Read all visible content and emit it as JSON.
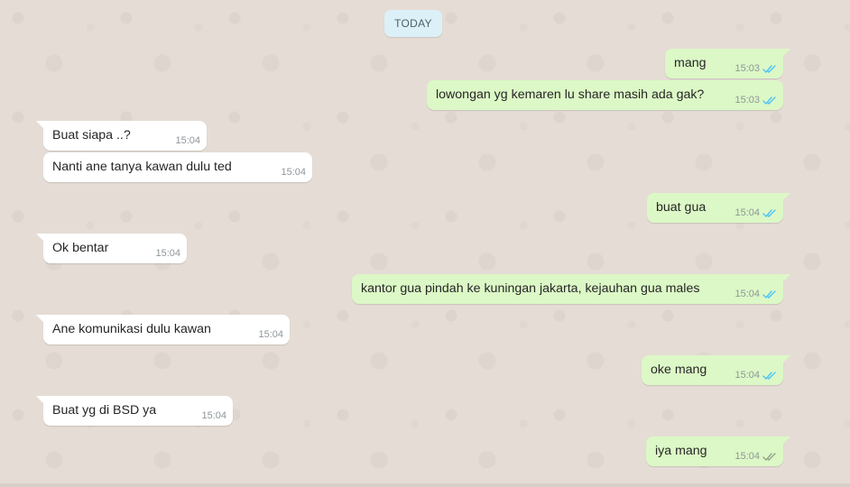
{
  "chat": {
    "date_divider": "TODAY",
    "colors": {
      "incoming_bubble": "#ffffff",
      "outgoing_bubble": "#dcf8c6",
      "read_tick": "#4fc3f7",
      "delivered_tick": "#92a58c",
      "wallpaper": "#e5ddd5"
    },
    "messages": [
      {
        "direction": "out",
        "text": "mang",
        "time": "15:03",
        "status": "read"
      },
      {
        "direction": "out",
        "text": "lowongan yg kemaren lu share masih ada gak?",
        "time": "15:03",
        "status": "read"
      },
      {
        "direction": "in",
        "text": "Buat siapa ..?",
        "time": "15:04"
      },
      {
        "direction": "in",
        "text": "Nanti ane tanya kawan dulu ted",
        "time": "15:04"
      },
      {
        "direction": "out",
        "text": "buat gua",
        "time": "15:04",
        "status": "read"
      },
      {
        "direction": "in",
        "text": "Ok bentar",
        "time": "15:04"
      },
      {
        "direction": "out",
        "text": "kantor gua pindah ke kuningan jakarta, kejauhan gua males",
        "time": "15:04",
        "status": "read"
      },
      {
        "direction": "in",
        "text": "Ane komunikasi dulu kawan",
        "time": "15:04"
      },
      {
        "direction": "out",
        "text": "oke mang",
        "time": "15:04",
        "status": "read"
      },
      {
        "direction": "in",
        "text": "Buat yg di BSD ya",
        "time": "15:04"
      },
      {
        "direction": "out",
        "text": "iya mang",
        "time": "15:04",
        "status": "delivered"
      }
    ]
  }
}
